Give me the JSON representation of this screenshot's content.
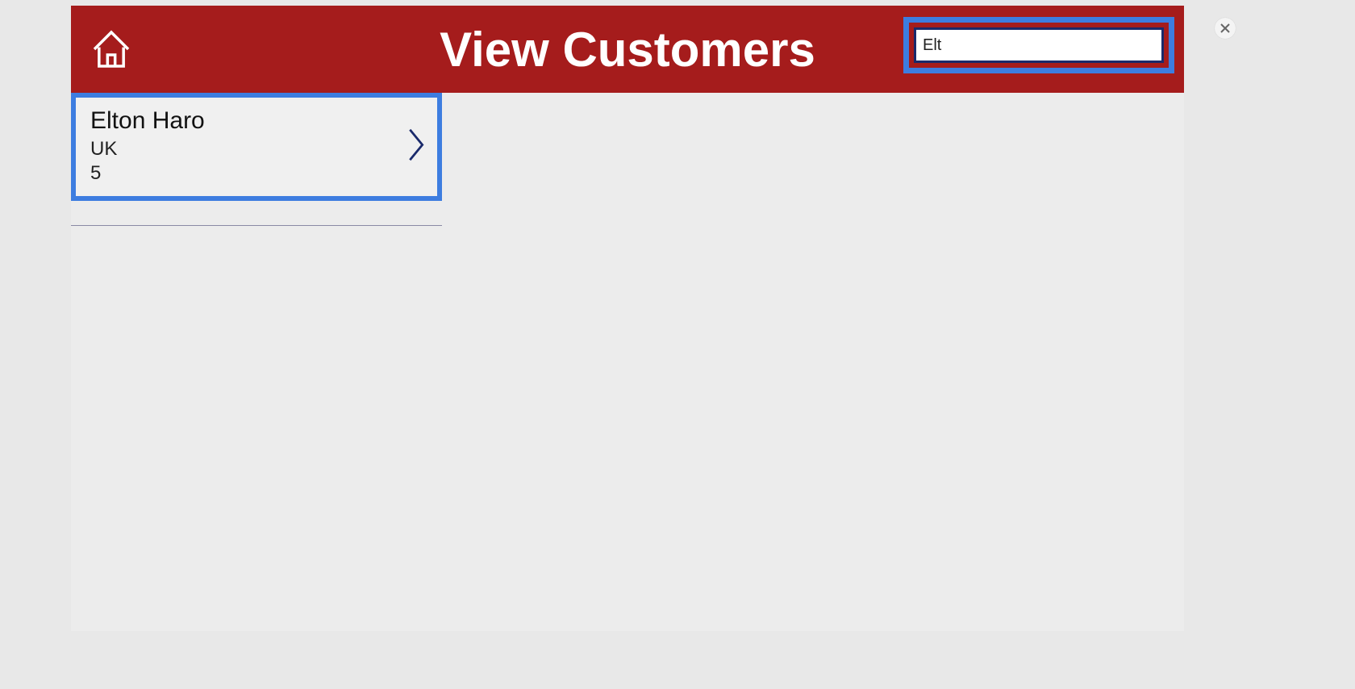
{
  "header": {
    "title": "View Customers"
  },
  "search": {
    "value": "Elt"
  },
  "customers": [
    {
      "name": "Elton  Haro",
      "country": "UK",
      "id": "5"
    }
  ],
  "colors": {
    "primary_red": "#a51c1c",
    "highlight_blue": "#3d7de0",
    "dark_navy": "#1a2a6b"
  }
}
